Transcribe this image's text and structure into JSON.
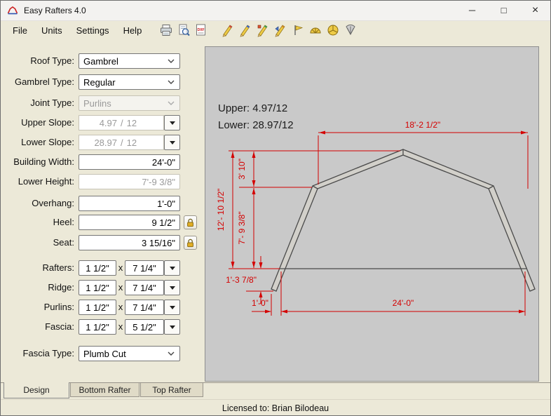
{
  "window": {
    "title": "Easy Rafters 4.0",
    "controls": {
      "minimize": "─",
      "maximize": "□",
      "close": "×"
    }
  },
  "menu": {
    "items": [
      "File",
      "Units",
      "Settings",
      "Help"
    ]
  },
  "toolbar": {
    "icons": [
      "print",
      "print-preview",
      "export-dxf",
      "draw-tool-1",
      "draw-tool-2",
      "draw-tool-3",
      "draw-tool-4",
      "flag-tool",
      "protractor-tool",
      "pie-tool",
      "fan-tool"
    ]
  },
  "form": {
    "fields": [
      {
        "label": "Roof Type:",
        "value": "Gambrel",
        "type": "combo",
        "enabled": true
      },
      {
        "label": "Gambrel Type:",
        "value": "Regular",
        "type": "combo",
        "enabled": true
      },
      {
        "label": "Joint Type:",
        "value": "Purlins",
        "type": "combo",
        "enabled": false
      },
      {
        "label": "Upper Slope:",
        "rise": "4.97",
        "sep": "/",
        "run": "12",
        "type": "slope",
        "enabled": false
      },
      {
        "label": "Lower Slope:",
        "rise": "28.97",
        "sep": "/",
        "run": "12",
        "type": "slope",
        "enabled": false
      },
      {
        "label": "Building Width:",
        "value": "24'-0\"",
        "type": "input",
        "enabled": true
      },
      {
        "label": "Lower Height:",
        "value": "7'-9 3/8\"",
        "type": "input",
        "enabled": false
      },
      {
        "label": "Overhang:",
        "value": "1'-0\"",
        "type": "input",
        "enabled": true
      },
      {
        "label": "Heel:",
        "value": "9 1/2\"",
        "type": "input",
        "enabled": true,
        "lock": true
      },
      {
        "label": "Seat:",
        "value": "3 15/16\"",
        "type": "input",
        "enabled": true,
        "lock": true
      },
      {
        "label": "Rafters:",
        "width": "1 1/2\"",
        "x": "x",
        "depth": "7 1/4\"",
        "type": "dims"
      },
      {
        "label": "Ridge:",
        "width": "1 1/2\"",
        "x": "x",
        "depth": "7 1/4\"",
        "type": "dims"
      },
      {
        "label": "Purlins:",
        "width": "1 1/2\"",
        "x": "x",
        "depth": "7 1/4\"",
        "type": "dims"
      },
      {
        "label": "Fascia:",
        "width": "1 1/2\"",
        "x": "x",
        "depth": "5 1/2\"",
        "type": "dims"
      },
      {
        "label": "Fascia Type:",
        "value": "Plumb Cut",
        "type": "combo",
        "enabled": true
      }
    ]
  },
  "diagram": {
    "upper_slope": "Upper: 4.97/12",
    "lower_slope": "Lower: 28.97/12",
    "dims": {
      "top_width": "18'-2 1/2\"",
      "upper_rise": "3' 10\"",
      "total_rise": "12'- 10 1/2\"",
      "lower_rise": "7'- 9 3/8\"",
      "tail_drop": "1'-3 7/8\"",
      "overhang": "1'-0\"",
      "building_width": "24'-0\""
    },
    "accent_color": "#d40000"
  },
  "tabs": {
    "items": [
      "Design",
      "Bottom Rafter",
      "Top Rafter"
    ],
    "active": "Design"
  },
  "status": {
    "text": "Licensed to: Brian Bilodeau"
  }
}
